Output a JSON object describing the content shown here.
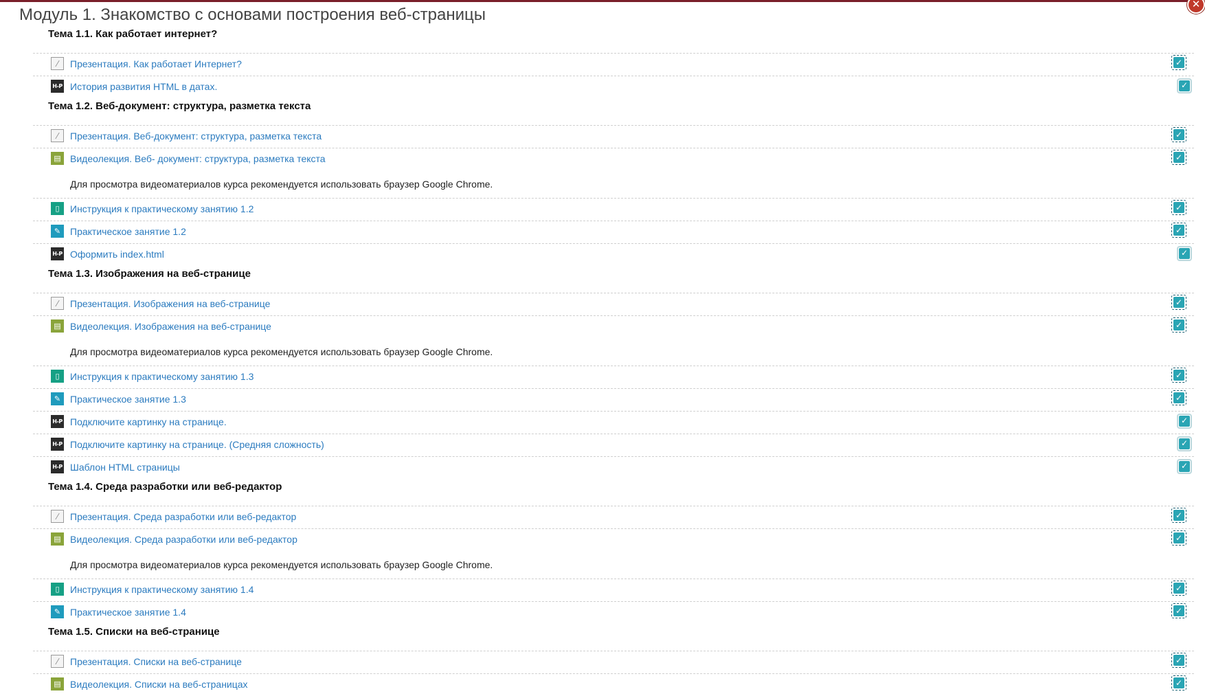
{
  "close_symbol": "✕",
  "module_title": "Модуль 1. Знакомство с основами построения веб-страницы",
  "colors": {
    "link": "#2b7bbf",
    "checkbox_fill": "#2aa5b4",
    "top_bar": "#7a1f2a",
    "close_button": "#c0392b"
  },
  "entries": [
    {
      "kind": "topic",
      "text": "Тема 1.1. Как работает интернет?"
    },
    {
      "kind": "activity",
      "icon": "pdf-icon",
      "text": "Презентация. Как работает Интернет?",
      "check": "auto"
    },
    {
      "kind": "activity",
      "icon": "h5p-icon",
      "text": "История развития HTML в датах.",
      "check": "manual"
    },
    {
      "kind": "topic",
      "text": "Тема 1.2. Веб-документ: структура, разметка текста"
    },
    {
      "kind": "activity",
      "icon": "pdf-icon",
      "text": "Презентация. Веб-документ: структура, разметка текста",
      "check": "auto"
    },
    {
      "kind": "activity",
      "icon": "video-icon",
      "text": "Видеолекция. Веб- документ: структура, разметка текста",
      "check": "auto"
    },
    {
      "kind": "note",
      "text": "Для просмотра видеоматериалов курса рекомендуется использовать браузер Google Chrome."
    },
    {
      "kind": "activity",
      "icon": "book-icon",
      "text": "Инструкция к практическому занятию 1.2",
      "check": "auto"
    },
    {
      "kind": "activity",
      "icon": "assignment-icon",
      "text": "Практическое занятие 1.2",
      "check": "auto"
    },
    {
      "kind": "activity",
      "icon": "h5p-icon",
      "text": "Оформить index.html",
      "check": "manual"
    },
    {
      "kind": "topic",
      "text": "Тема 1.3. Изображения на веб-странице"
    },
    {
      "kind": "activity",
      "icon": "pdf-icon",
      "text": "Презентация. Изображения на веб-странице",
      "check": "auto"
    },
    {
      "kind": "activity",
      "icon": "video-icon",
      "text": "Видеолекция. Изображения на веб-странице",
      "check": "auto"
    },
    {
      "kind": "note",
      "text": "Для просмотра видеоматериалов курса рекомендуется использовать браузер Google Chrome."
    },
    {
      "kind": "activity",
      "icon": "book-icon",
      "text": "Инструкция к практическому занятию 1.3",
      "check": "auto"
    },
    {
      "kind": "activity",
      "icon": "assignment-icon",
      "text": "Практическое занятие 1.3",
      "check": "auto"
    },
    {
      "kind": "activity",
      "icon": "h5p-icon",
      "text": "Подключите картинку на странице.",
      "check": "manual"
    },
    {
      "kind": "activity",
      "icon": "h5p-icon",
      "text": "Подключите картинку на странице. (Средняя сложность)",
      "check": "manual"
    },
    {
      "kind": "activity",
      "icon": "h5p-icon",
      "text": "Шаблон HTML страницы",
      "check": "manual"
    },
    {
      "kind": "topic",
      "text": "Тема 1.4. Среда разработки или веб-редактор"
    },
    {
      "kind": "activity",
      "icon": "pdf-icon",
      "text": "Презентация. Среда разработки или веб-редактор",
      "check": "auto"
    },
    {
      "kind": "activity",
      "icon": "video-icon",
      "text": "Видеолекция. Среда разработки или веб-редактор",
      "check": "auto"
    },
    {
      "kind": "note",
      "text": "Для просмотра видеоматериалов курса рекомендуется использовать браузер Google Chrome."
    },
    {
      "kind": "activity",
      "icon": "book-icon",
      "text": "Инструкция к практическому занятию 1.4",
      "check": "auto"
    },
    {
      "kind": "activity",
      "icon": "assignment-icon",
      "text": "Практическое занятие 1.4",
      "check": "auto"
    },
    {
      "kind": "topic",
      "text": "Тема 1.5. Списки на веб-странице"
    },
    {
      "kind": "activity",
      "icon": "pdf-icon",
      "text": "Презентация. Списки на веб-странице",
      "check": "auto"
    },
    {
      "kind": "activity",
      "icon": "video-icon",
      "text": "Видеолекция. Списки на веб-страницах",
      "check": "auto"
    }
  ]
}
